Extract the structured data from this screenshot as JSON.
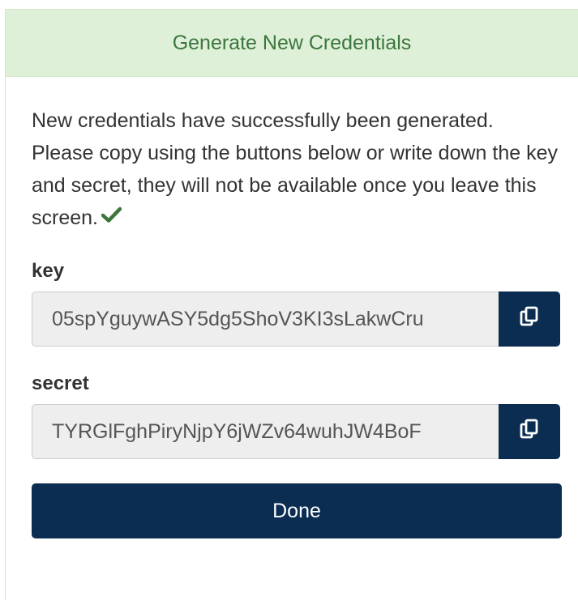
{
  "panel": {
    "title": "Generate New Credentials",
    "message": "New credentials have successfully been generated. Please copy using the buttons below or write down the key and secret, they will not be available once you leave this screen.",
    "message_icon": "check-icon",
    "key": {
      "label": "key",
      "value": "05spYguywASY5dg5ShoV3KI3sLakwCru",
      "copy_icon": "copy-icon"
    },
    "secret": {
      "label": "secret",
      "value": "TYRGlFghPiryNjpY6jWZv64wuhJW4BoF",
      "copy_icon": "copy-icon"
    },
    "done_label": "Done"
  },
  "colors": {
    "heading_bg": "#dff0d8",
    "heading_text": "#3c763d",
    "check_icon": "#3c763d",
    "button_bg": "#0b2d52",
    "input_bg": "#eeeeee"
  }
}
